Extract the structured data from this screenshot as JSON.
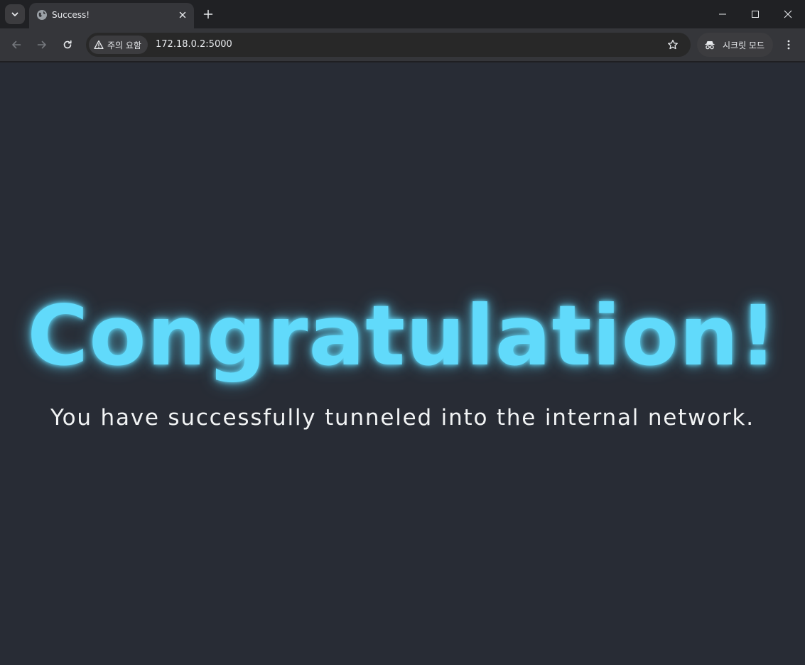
{
  "browser": {
    "tab": {
      "title": "Success!"
    },
    "address": {
      "security_label": "주의 요함",
      "url": "172.18.0.2:5000"
    },
    "profile": {
      "label": "시크릿 모드"
    },
    "icons": {
      "tab_search": "chevron-down-icon",
      "favicon": "globe-icon",
      "tab_close": "close-icon",
      "new_tab": "plus-icon",
      "minimize": "minimize-icon",
      "maximize": "maximize-icon",
      "close_window": "close-icon",
      "back": "arrow-left-icon",
      "forward": "arrow-right-icon",
      "reload": "reload-icon",
      "warning": "warning-icon",
      "bookmark": "star-icon",
      "incognito": "incognito-icon",
      "menu": "kebab-menu-icon"
    }
  },
  "page": {
    "headline": "Congratulation!",
    "message": "You have successfully tunneled into the internal network."
  },
  "colors": {
    "page_background": "#282c35",
    "headline": "#61dafb",
    "message": "#f1f3f4"
  }
}
